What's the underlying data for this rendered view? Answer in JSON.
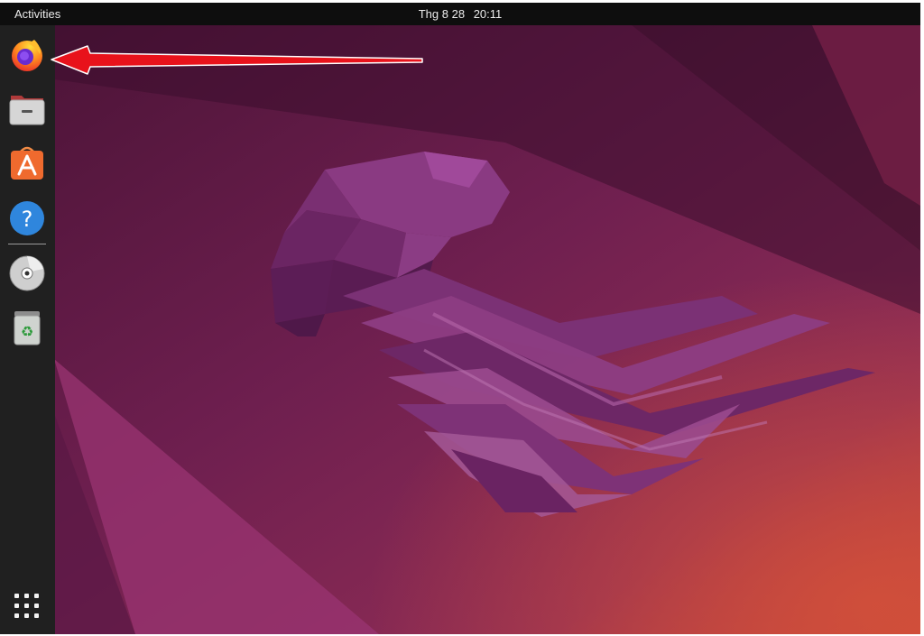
{
  "topbar": {
    "activities_label": "Activities",
    "clock_date": "Thg 8 28",
    "clock_time": "20:11"
  },
  "dock": {
    "items": [
      {
        "name": "firefox",
        "icon": "firefox-icon"
      },
      {
        "name": "files",
        "icon": "folder-icon"
      },
      {
        "name": "app-center",
        "icon": "app-store-icon"
      },
      {
        "name": "help",
        "icon": "help-icon"
      },
      {
        "name": "disc",
        "icon": "cd-disc-icon"
      },
      {
        "name": "trash",
        "icon": "trash-icon"
      }
    ],
    "show_apps_icon": "grid-icon"
  },
  "annotation": {
    "type": "arrow",
    "color": "#e8121b",
    "target": "firefox"
  },
  "colors": {
    "topbar": "#0e0e0e",
    "dock": "#202020",
    "wallpaper_base": "#6e1f4f",
    "wallpaper_accent": "#c8453a"
  }
}
